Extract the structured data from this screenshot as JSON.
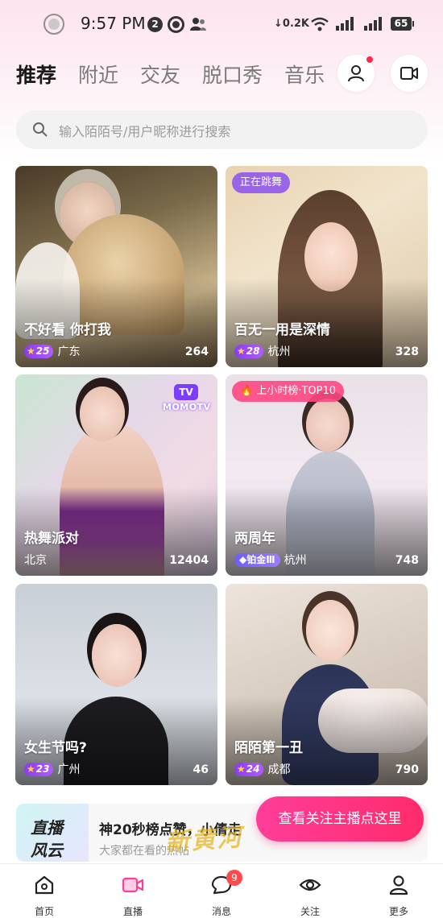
{
  "status_bar": {
    "time": "9:57 PM",
    "notification_count": "2",
    "network_speed": "0.2K",
    "battery": "65"
  },
  "header": {
    "tabs": [
      {
        "label": "推荐",
        "active": true
      },
      {
        "label": "附近",
        "active": false
      },
      {
        "label": "交友",
        "active": false
      },
      {
        "label": "脱口秀",
        "active": false
      },
      {
        "label": "音乐",
        "active": false
      }
    ],
    "icons": [
      "user-icon",
      "video-camera-icon"
    ]
  },
  "search": {
    "placeholder": "输入陌陌号/用户昵称进行搜索"
  },
  "cards": [
    {
      "title": "不好看 你打我",
      "level": "25",
      "city": "广东",
      "viewers": "264",
      "tag": ""
    },
    {
      "title": "百无一用是深情",
      "level": "28",
      "city": "杭州",
      "viewers": "328",
      "tag": "正在跳舞"
    },
    {
      "title": "热舞派对",
      "level": "",
      "city": "北京",
      "viewers": "12404",
      "tag": "",
      "logo_tv": "TV",
      "logo_word": "MOMOTV"
    },
    {
      "title": "两周年",
      "level": "铂金Ⅲ",
      "city": "杭州",
      "viewers": "748",
      "tag": "上小时榜·TOP10"
    },
    {
      "title": "女生节吗?",
      "level": "23",
      "city": "广州",
      "viewers": "46",
      "tag": ""
    },
    {
      "title": "陌陌第一丑",
      "level": "24",
      "city": "成都",
      "viewers": "790",
      "tag": ""
    }
  ],
  "promo": {
    "logo_line1": "直播",
    "logo_line2": "风云",
    "title": "神20秒榜点赞，小倩走",
    "subtitle": "大家都在看的热帖"
  },
  "follow_button": "查看关注主播点这里",
  "watermark": "新黄河",
  "bottom_nav": [
    {
      "label": "首页",
      "icon": "home-icon"
    },
    {
      "label": "直播",
      "icon": "live-video-icon",
      "active": true
    },
    {
      "label": "消息",
      "icon": "message-icon",
      "badge": "9"
    },
    {
      "label": "关注",
      "icon": "eye-icon"
    },
    {
      "label": "更多",
      "icon": "person-icon"
    }
  ],
  "colors": {
    "accent_pink": "#ff2b6b",
    "level_purple": "#8a3cf2",
    "live_nav_icon": "#ff3d9a"
  }
}
